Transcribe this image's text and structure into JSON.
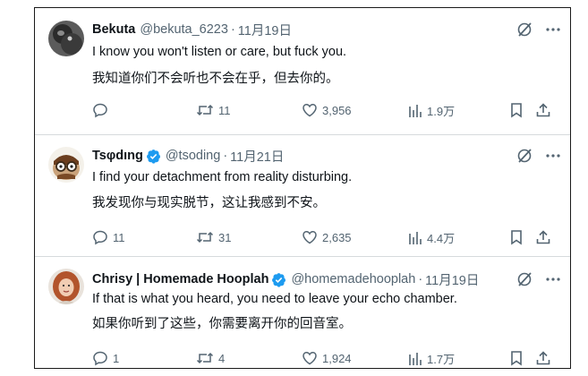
{
  "tweets": [
    {
      "name": "Bekuta",
      "handle": "@bekuta_6223",
      "separator": "·",
      "date": "11月19日",
      "verified": false,
      "lines": [
        "I know you won't listen or care, but fuck you.",
        "我知道你们不会听也不会在乎，但去你的。"
      ],
      "replies": "",
      "retweets": "11",
      "likes": "3,956",
      "views": "1.9万"
    },
    {
      "name": "Tsφdıng",
      "handle": "@tsoding",
      "separator": "·",
      "date": "11月21日",
      "verified": true,
      "lines": [
        "I find your detachment from reality disturbing.",
        "我发现你与现实脱节，这让我感到不安。"
      ],
      "replies": "11",
      "retweets": "31",
      "likes": "2,635",
      "views": "4.4万"
    },
    {
      "name": "Chrisy | Homemade Hooplah",
      "handle": "@homemadehooplah",
      "separator": "·",
      "date": "11月19日",
      "verified": true,
      "lines": [
        "If that is what you heard, you need to leave your echo chamber.",
        "如果你听到了这些，你需要离开你的回音室。"
      ],
      "replies": "1",
      "retweets": "4",
      "likes": "1,924",
      "views": "1.7万"
    }
  ],
  "icons": [
    "grok-icon",
    "more-icon",
    "reply-icon",
    "retweet-icon",
    "like-icon",
    "views-icon",
    "bookmark-icon",
    "share-icon",
    "verified-icon"
  ],
  "colors": {
    "verified": "#1d9bf0",
    "secondary_text": "#536471",
    "divider": "#d6dadd"
  }
}
